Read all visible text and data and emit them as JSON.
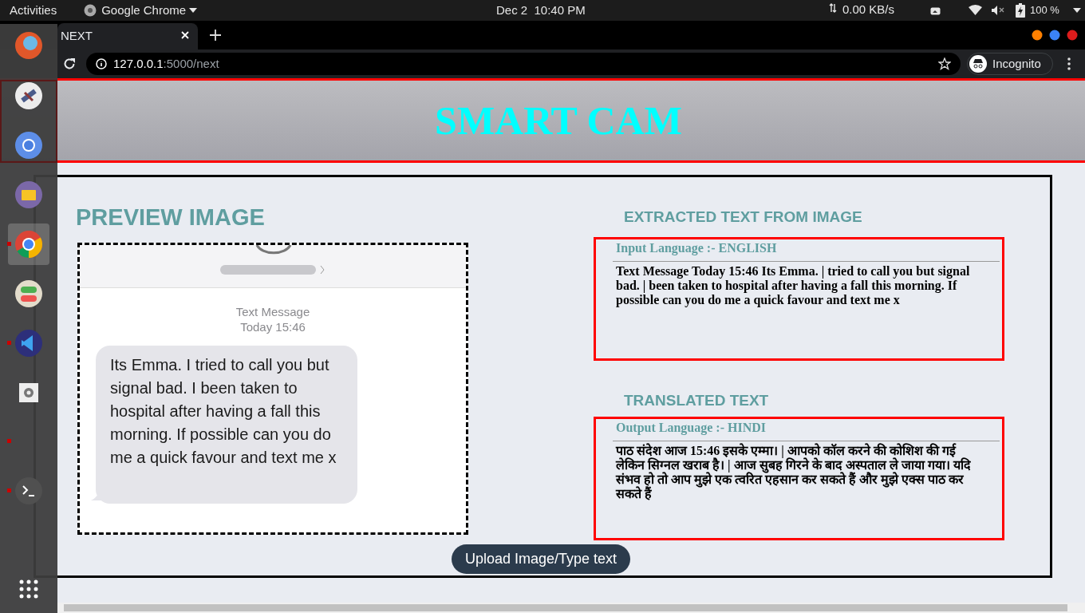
{
  "top_bar": {
    "activities": "Activities",
    "app_menu": "Google Chrome",
    "clock": "Dec 2  10:40 PM",
    "network_speed": "0.00 KB/s",
    "battery": "100 %"
  },
  "browser": {
    "tab_title": "NEXT",
    "address_host": "127.0.0.1",
    "address_path": ":5000/next",
    "incognito": "Incognito"
  },
  "dock": [
    {
      "kind": "firefox",
      "running": false,
      "selected": false
    },
    {
      "kind": "satellite",
      "running": false,
      "selected": false
    },
    {
      "kind": "chromium",
      "running": false,
      "selected": false
    },
    {
      "kind": "files",
      "running": false,
      "selected": false
    },
    {
      "kind": "chrome",
      "running": true,
      "selected": true
    },
    {
      "kind": "toggles",
      "running": false,
      "selected": false
    },
    {
      "kind": "vscode",
      "running": true,
      "selected": false
    },
    {
      "kind": "settings",
      "running": false,
      "selected": false
    },
    {
      "kind": "empty",
      "running": true,
      "selected": false
    },
    {
      "kind": "terminal",
      "running": true,
      "selected": false
    }
  ],
  "page": {
    "title": "SMART CAM",
    "preview": {
      "heading": "PREVIEW IMAGE",
      "image": {
        "header": "Text Message",
        "time": "Today 15:46",
        "bubble": "Its Emma. I tried to call you but signal bad. I been taken to hospital after having a fall this morning. If possible can you do me a quick favour and text me x"
      }
    },
    "extracted": {
      "heading": "EXTRACTED TEXT FROM IMAGE",
      "language": "Input Language :- ENGLISH",
      "text": "Text Message Today 15:46 Its Emma. | tried to call you but signal bad. | been taken to hospital after having a fall this morning. If possible can you do me a quick favour and text me x"
    },
    "translated": {
      "heading": "TRANSLATED TEXT",
      "language": "Output Language :- HINDI",
      "text": "पाठ संदेश आज 15:46 इसके एम्मा। | आपको कॉल करने की कोशिश की गई लेकिन सिग्नल खराब है। | आज सुबह गिरने के बाद अस्पताल ले जाया गया। यदि संभव हो तो आप मुझे एक त्वरित एहसान कर सकते हैं और मुझे एक्स पाठ कर सकते हैं"
    },
    "button": "Upload Image/Type text"
  }
}
